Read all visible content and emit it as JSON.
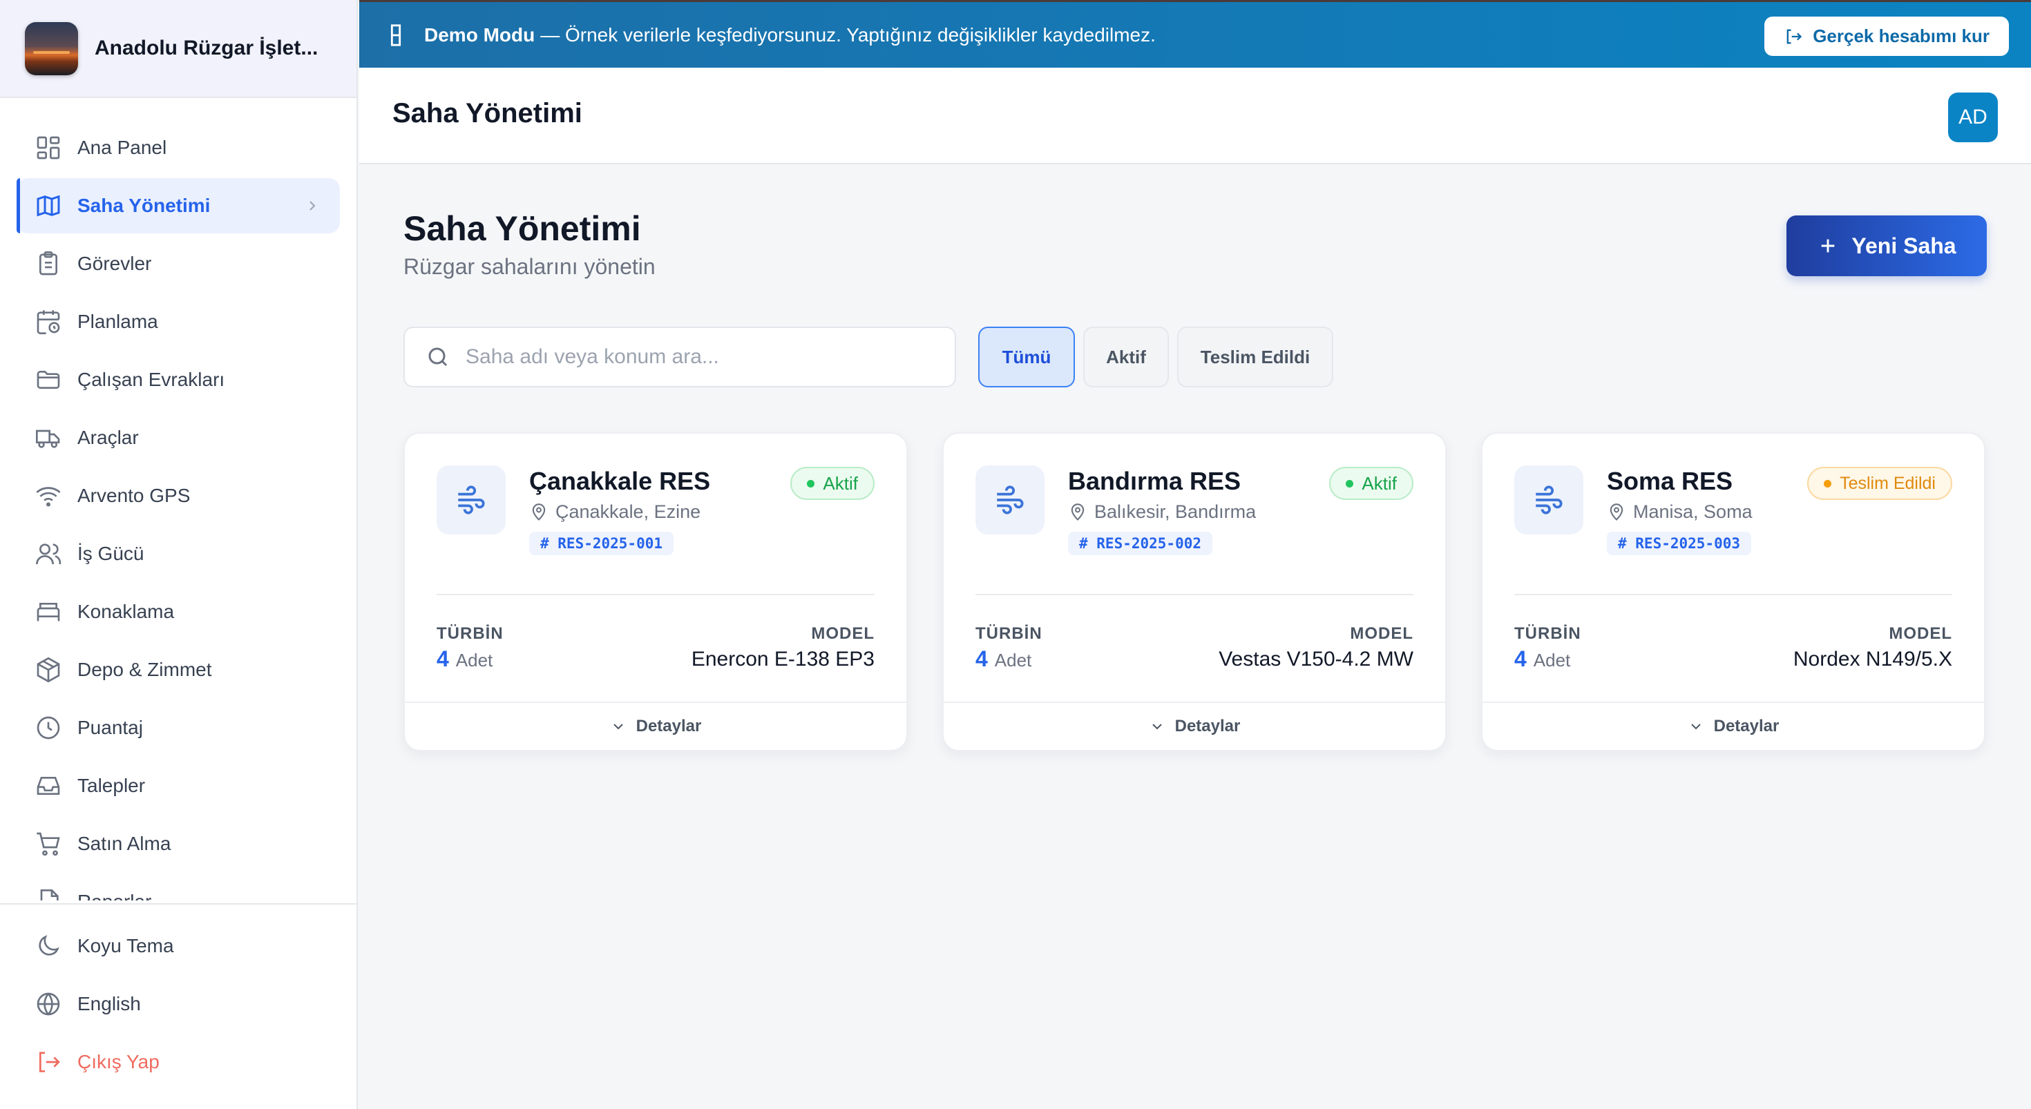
{
  "brand": {
    "name": "Anadolu Rüzgar İşlet..."
  },
  "sidebar": {
    "items": [
      {
        "label": "Ana Panel",
        "icon": "dashboard-icon"
      },
      {
        "label": "Saha Yönetimi",
        "icon": "map-icon",
        "active": true
      },
      {
        "label": "Görevler",
        "icon": "clipboard-icon"
      },
      {
        "label": "Planlama",
        "icon": "calendar-clock-icon"
      },
      {
        "label": "Çalışan Evrakları",
        "icon": "folder-icon"
      },
      {
        "label": "Araçlar",
        "icon": "truck-icon"
      },
      {
        "label": "Arvento GPS",
        "icon": "wifi-icon"
      },
      {
        "label": "İş Gücü",
        "icon": "users-icon"
      },
      {
        "label": "Konaklama",
        "icon": "bed-icon"
      },
      {
        "label": "Depo & Zimmet",
        "icon": "package-icon"
      },
      {
        "label": "Puantaj",
        "icon": "clock-icon"
      },
      {
        "label": "Talepler",
        "icon": "inbox-icon"
      },
      {
        "label": "Satın Alma",
        "icon": "cart-icon"
      },
      {
        "label": "Raporlar",
        "icon": "file-icon"
      }
    ],
    "bottom": [
      {
        "label": "Koyu Tema",
        "icon": "moon-icon"
      },
      {
        "label": "English",
        "icon": "globe-icon"
      },
      {
        "label": "Çıkış Yap",
        "icon": "logout-icon"
      }
    ]
  },
  "demo": {
    "strong": "Demo Modu",
    "message": "— Örnek verilerle keşfediyorsunuz. Yaptığınız değişiklikler kaydedilmez.",
    "button": "Gerçek hesabımı kur"
  },
  "header": {
    "title": "Saha Yönetimi",
    "avatar": "AD"
  },
  "page": {
    "title": "Saha Yönetimi",
    "subtitle": "Rüzgar sahalarını yönetin",
    "new_button": "Yeni Saha",
    "search_placeholder": "Saha adı veya konum ara...",
    "filters": [
      "Tümü",
      "Aktif",
      "Teslim Edildi"
    ]
  },
  "cards": [
    {
      "name": "Çanakkale RES",
      "location": "Çanakkale, Ezine",
      "code": "# RES-2025-001",
      "status": "Aktif",
      "turbine_label": "TÜRBİN",
      "turbine_count": "4",
      "turbine_unit": "Adet",
      "model_label": "MODEL",
      "model": "Enercon E-138 EP3",
      "details": "Detaylar"
    },
    {
      "name": "Bandırma RES",
      "location": "Balıkesir, Bandırma",
      "code": "# RES-2025-002",
      "status": "Aktif",
      "turbine_label": "TÜRBİN",
      "turbine_count": "4",
      "turbine_unit": "Adet",
      "model_label": "MODEL",
      "model": "Vestas V150-4.2 MW",
      "details": "Detaylar"
    },
    {
      "name": "Soma RES",
      "location": "Manisa, Soma",
      "code": "# RES-2025-003",
      "status": "Teslim Edildi",
      "turbine_label": "TÜRBİN",
      "turbine_count": "4",
      "turbine_unit": "Adet",
      "model_label": "MODEL",
      "model": "Nordex N149/5.X",
      "details": "Detaylar"
    }
  ],
  "colors": {
    "accent": "#2563eb",
    "banner": "#0b83c2",
    "active_green": "#16a34a",
    "delivered_orange": "#e08a0e"
  }
}
